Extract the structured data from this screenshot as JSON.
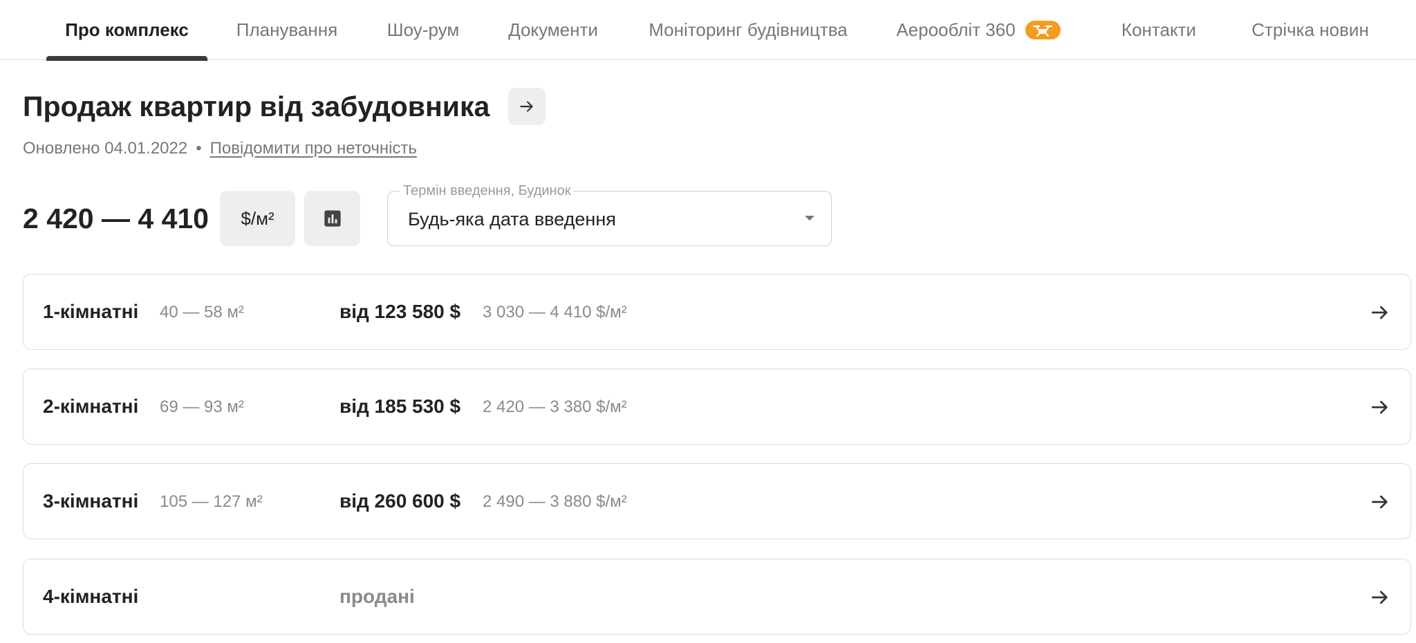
{
  "tabs": [
    {
      "label": "Про комплекс",
      "active": true
    },
    {
      "label": "Планування"
    },
    {
      "label": "Шоу-рум"
    },
    {
      "label": "Документи"
    },
    {
      "label": "Моніторинг будівництва"
    },
    {
      "label": "Аерообліт 360",
      "badge_icon": "drone-icon"
    },
    {
      "label": "Контакти"
    },
    {
      "label": "Стрічка новин"
    }
  ],
  "header": {
    "title": "Продаж квартир від забудовника",
    "updated": "Оновлено 04.01.2022",
    "separator": "•",
    "report_link": "Повідомити про неточність"
  },
  "price": {
    "range": "2 420 — 4 410",
    "unit_button": "$/м²",
    "chart_icon": "bar-chart-icon"
  },
  "filter": {
    "legend": "Термін введення, Будинок",
    "value": "Будь-яка дата введення"
  },
  "rooms": [
    {
      "name": "1-кімнатні",
      "area": "40 — 58 м²",
      "price": "від 123 580 $",
      "per_sqm": "3 030 — 4 410 $/м²"
    },
    {
      "name": "2-кімнатні",
      "area": "69 — 93 м²",
      "price": "від 185 530 $",
      "per_sqm": "2 420 — 3 380 $/м²"
    },
    {
      "name": "3-кімнатні",
      "area": "105 — 127 м²",
      "price": "від 260 600 $",
      "per_sqm": "2 490 — 3 880 $/м²"
    },
    {
      "name": "4-кімнатні",
      "area": "",
      "price": "продані",
      "per_sqm": "",
      "sold": true
    }
  ],
  "colors": {
    "accent_badge": "#f39c1f",
    "active_underline": "#3a3a3a",
    "muted_text": "#777777"
  }
}
